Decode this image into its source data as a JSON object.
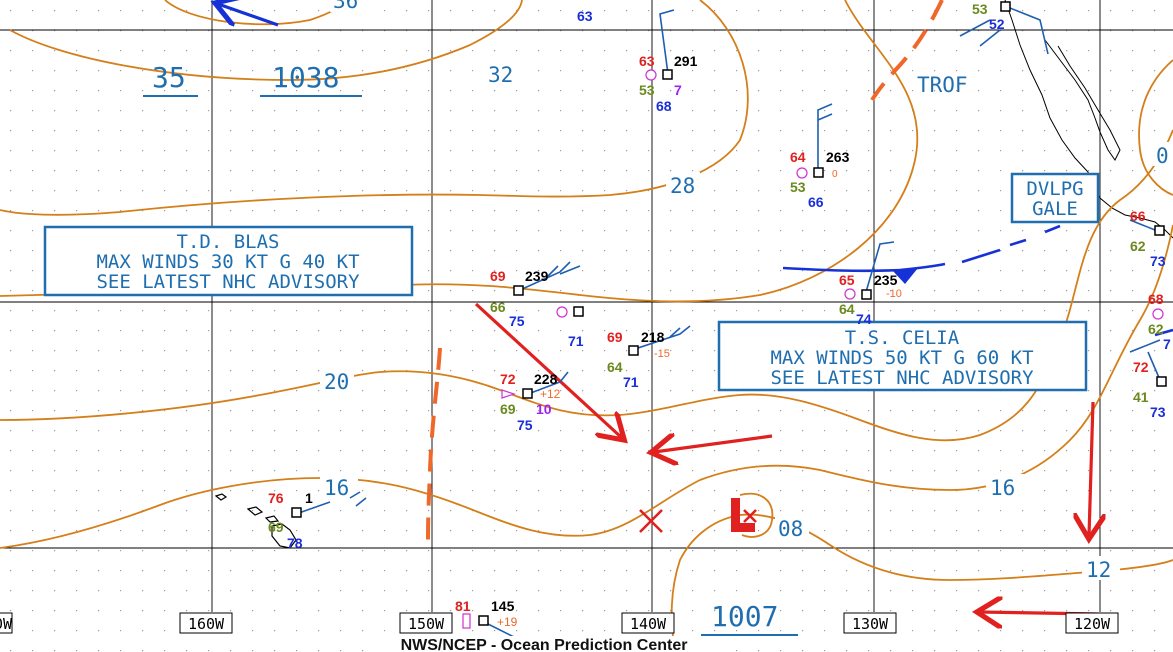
{
  "footer": {
    "credit": "NWS/NCEP - Ocean Prediction Center"
  },
  "longitudes": [
    "160W",
    "150W",
    "140W",
    "130W",
    "120W"
  ],
  "partial_lon_left": "0W",
  "highs": [
    {
      "pressure_tens": "35",
      "pressure": "1038"
    }
  ],
  "lows": [
    {
      "pressure": "1007",
      "suffix": "08"
    }
  ],
  "isobar_labels": [
    "36",
    "32",
    "28",
    "20",
    "16",
    "16",
    "12",
    "0",
    "08"
  ],
  "boxes": {
    "blas": {
      "l1": "T.D. BLAS",
      "l2": "MAX WINDS 30 KT G 40 KT",
      "l3": "SEE LATEST NHC ADVISORY"
    },
    "celia": {
      "l1": "T.S. CELIA",
      "l2": "MAX WINDS 50 KT G 60 KT",
      "l3": "SEE LATEST NHC ADVISORY"
    },
    "gale": {
      "l1": "DVLPG",
      "l2": "GALE"
    }
  },
  "labels": {
    "trof": "TROF"
  },
  "stations": [
    {
      "t": "63",
      "p": "291",
      "d": "53",
      "dp": "7",
      "v": "68"
    },
    {
      "t": "64",
      "p": "263",
      "d": "53",
      "dp": "0",
      "v": "66"
    },
    {
      "t": "69",
      "p": "239",
      "d": "66",
      "v": "75"
    },
    {
      "v": "71"
    },
    {
      "t": "69",
      "p": "218",
      "d": "64",
      "dp": "-15",
      "v": "71"
    },
    {
      "t": "72",
      "p": "228",
      "d": "69",
      "dp": "+12",
      "pc": "10",
      "v": "75"
    },
    {
      "t": "65",
      "p": "235",
      "d": "64",
      "dp": "-10",
      "v": "74"
    },
    {
      "t": "76",
      "p": "1",
      "d": "69",
      "v": "78"
    },
    {
      "t": "81",
      "p": "145",
      "dp": "+19"
    },
    {
      "t": "53",
      "v": "52"
    },
    {
      "t": "66",
      "d": "62",
      "v": "73"
    },
    {
      "t": "68",
      "d": "62",
      "v": "7"
    },
    {
      "t": "72",
      "d": "41",
      "v": "73"
    }
  ],
  "top_value": "63"
}
